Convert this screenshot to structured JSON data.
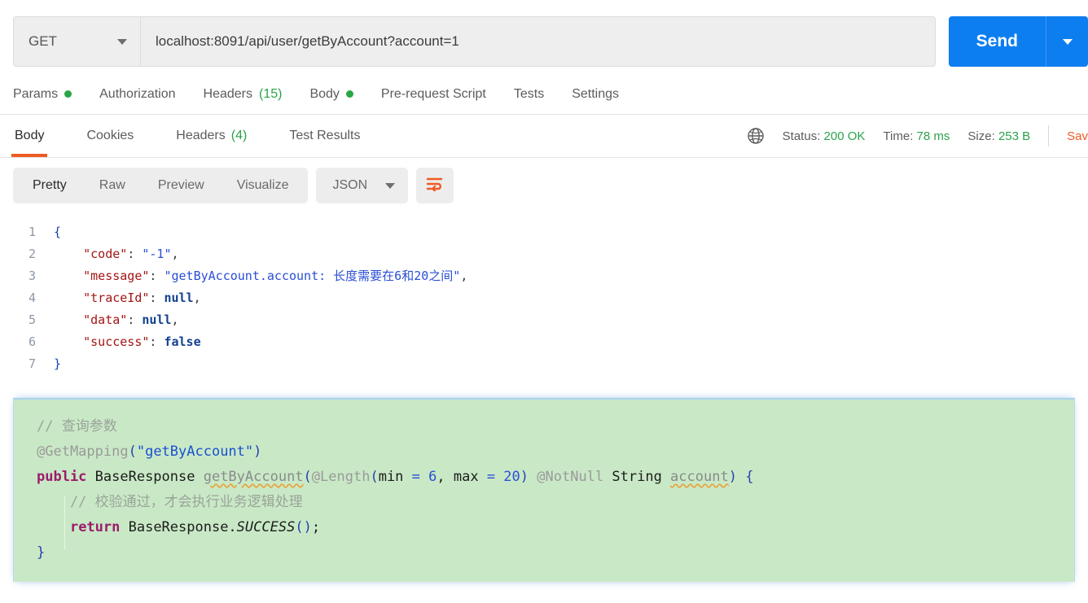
{
  "request": {
    "method": "GET",
    "url": "localhost:8091/api/user/getByAccount?account=1",
    "send_label": "Send"
  },
  "request_tabs": [
    {
      "label": "Params",
      "badge_dot": true
    },
    {
      "label": "Authorization"
    },
    {
      "label": "Headers",
      "count": "(15)"
    },
    {
      "label": "Body",
      "badge_dot": true
    },
    {
      "label": "Pre-request Script"
    },
    {
      "label": "Tests"
    },
    {
      "label": "Settings"
    }
  ],
  "response_tabs": [
    {
      "label": "Body",
      "active": true
    },
    {
      "label": "Cookies"
    },
    {
      "label": "Headers",
      "count": "(4)"
    },
    {
      "label": "Test Results"
    }
  ],
  "response_meta": {
    "status_label": "Status:",
    "status_value": "200 OK",
    "time_label": "Time:",
    "time_value": "78 ms",
    "size_label": "Size:",
    "size_value": "253 B",
    "save_response": "Sav"
  },
  "format_toolbar": {
    "views": [
      "Pretty",
      "Raw",
      "Preview",
      "Visualize"
    ],
    "active_view": "Pretty",
    "language": "JSON"
  },
  "json_lines": [
    {
      "n": "1",
      "segments": [
        {
          "t": "{",
          "c": "j-brace"
        }
      ]
    },
    {
      "n": "2",
      "segments": [
        {
          "t": "    ",
          "c": "j-punct"
        },
        {
          "t": "\"code\"",
          "c": "j-key"
        },
        {
          "t": ": ",
          "c": "j-punct"
        },
        {
          "t": "\"-1\"",
          "c": "j-str"
        },
        {
          "t": ",",
          "c": "j-punct"
        }
      ]
    },
    {
      "n": "3",
      "segments": [
        {
          "t": "    ",
          "c": "j-punct"
        },
        {
          "t": "\"message\"",
          "c": "j-key"
        },
        {
          "t": ": ",
          "c": "j-punct"
        },
        {
          "t": "\"getByAccount.account: 长度需要在6和20之间\"",
          "c": "j-str"
        },
        {
          "t": ",",
          "c": "j-punct"
        }
      ]
    },
    {
      "n": "4",
      "segments": [
        {
          "t": "    ",
          "c": "j-punct"
        },
        {
          "t": "\"traceId\"",
          "c": "j-key"
        },
        {
          "t": ": ",
          "c": "j-punct"
        },
        {
          "t": "null",
          "c": "j-lit"
        },
        {
          "t": ",",
          "c": "j-punct"
        }
      ]
    },
    {
      "n": "5",
      "segments": [
        {
          "t": "    ",
          "c": "j-punct"
        },
        {
          "t": "\"data\"",
          "c": "j-key"
        },
        {
          "t": ": ",
          "c": "j-punct"
        },
        {
          "t": "null",
          "c": "j-lit"
        },
        {
          "t": ",",
          "c": "j-punct"
        }
      ]
    },
    {
      "n": "6",
      "segments": [
        {
          "t": "    ",
          "c": "j-punct"
        },
        {
          "t": "\"success\"",
          "c": "j-key"
        },
        {
          "t": ": ",
          "c": "j-punct"
        },
        {
          "t": "false",
          "c": "j-lit"
        }
      ]
    },
    {
      "n": "7",
      "segments": [
        {
          "t": "}",
          "c": "j-brace"
        }
      ]
    }
  ],
  "code_panel": {
    "lines": [
      [
        {
          "t": "// 查询参数",
          "c": "c-comment"
        }
      ],
      [
        {
          "t": "@GetMapping",
          "c": "c-anno"
        },
        {
          "t": "(",
          "c": "c-paren"
        },
        {
          "t": "\"getByAccount\"",
          "c": "c-str"
        },
        {
          "t": ")",
          "c": "c-paren"
        }
      ],
      [
        {
          "t": "public",
          "c": "c-kw"
        },
        {
          "t": " BaseResponse ",
          "c": "c-type"
        },
        {
          "t": "getByAccount",
          "c": "c-warn"
        },
        {
          "t": "(",
          "c": "c-paren"
        },
        {
          "t": "@Length",
          "c": "c-anno"
        },
        {
          "t": "(",
          "c": "c-paren"
        },
        {
          "t": "min ",
          "c": "c-type"
        },
        {
          "t": "= ",
          "c": "c-num"
        },
        {
          "t": "6",
          "c": "c-num"
        },
        {
          "t": ", max ",
          "c": "c-type"
        },
        {
          "t": "= ",
          "c": "c-num"
        },
        {
          "t": "20",
          "c": "c-num"
        },
        {
          "t": ")",
          "c": "c-paren"
        },
        {
          "t": " @NotNull",
          "c": "c-anno"
        },
        {
          "t": " String ",
          "c": "c-type"
        },
        {
          "t": "account",
          "c": "c-warn"
        },
        {
          "t": ")",
          "c": "c-paren"
        },
        {
          "t": " {",
          "c": "c-paren"
        }
      ],
      [
        {
          "t": "    // 校验通过，才会执行业务逻辑处理",
          "c": "c-comment"
        }
      ],
      [
        {
          "t": "    ",
          "c": "c-type"
        },
        {
          "t": "return",
          "c": "c-kw"
        },
        {
          "t": " BaseResponse.",
          "c": "c-type"
        },
        {
          "t": "SUCCESS",
          "c": "c-italic"
        },
        {
          "t": "()",
          "c": "c-paren"
        },
        {
          "t": ";",
          "c": "c-type"
        }
      ],
      [
        {
          "t": "}",
          "c": "c-paren"
        }
      ]
    ]
  }
}
